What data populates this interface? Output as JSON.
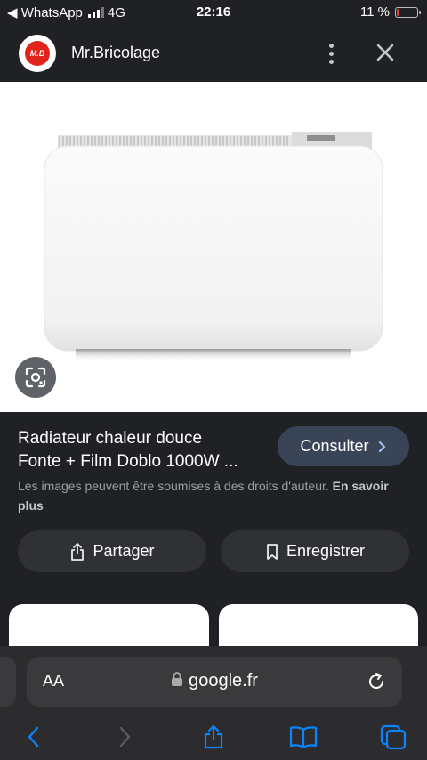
{
  "status_bar": {
    "back_app": "◀ WhatsApp",
    "network": "4G",
    "time": "22:16",
    "battery": "11 %",
    "battery_level": 0.11,
    "battery_color": "#e53935"
  },
  "header": {
    "logo_text": "M.B",
    "site_name": "Mr.Bricolage"
  },
  "result": {
    "title_line1": "Radiateur chaleur douce",
    "title_line2": "Fonte + Film Doblo 1000W ...",
    "consult_label": "Consulter",
    "copyright_text": "Les images peuvent être soumises à des droits d'auteur.",
    "learn_more": "En savoir plus",
    "share_label": "Partager",
    "save_label": "Enregistrer"
  },
  "browser": {
    "text_size_label": "AA",
    "url": "google.fr"
  },
  "icons": {
    "lens": "lens-icon",
    "more": "more-vert-icon",
    "close": "close-icon",
    "share": "share-icon",
    "bookmark": "bookmark-icon",
    "lock": "lock-icon",
    "reload": "reload-icon",
    "back": "chevron-left-icon",
    "forward": "chevron-right-icon",
    "books": "book-icon",
    "tabs": "tabs-icon"
  },
  "colors": {
    "background": "#202124",
    "accent": "#0a84ff",
    "consult_button": "#394457",
    "brand_red": "#e2231a"
  }
}
